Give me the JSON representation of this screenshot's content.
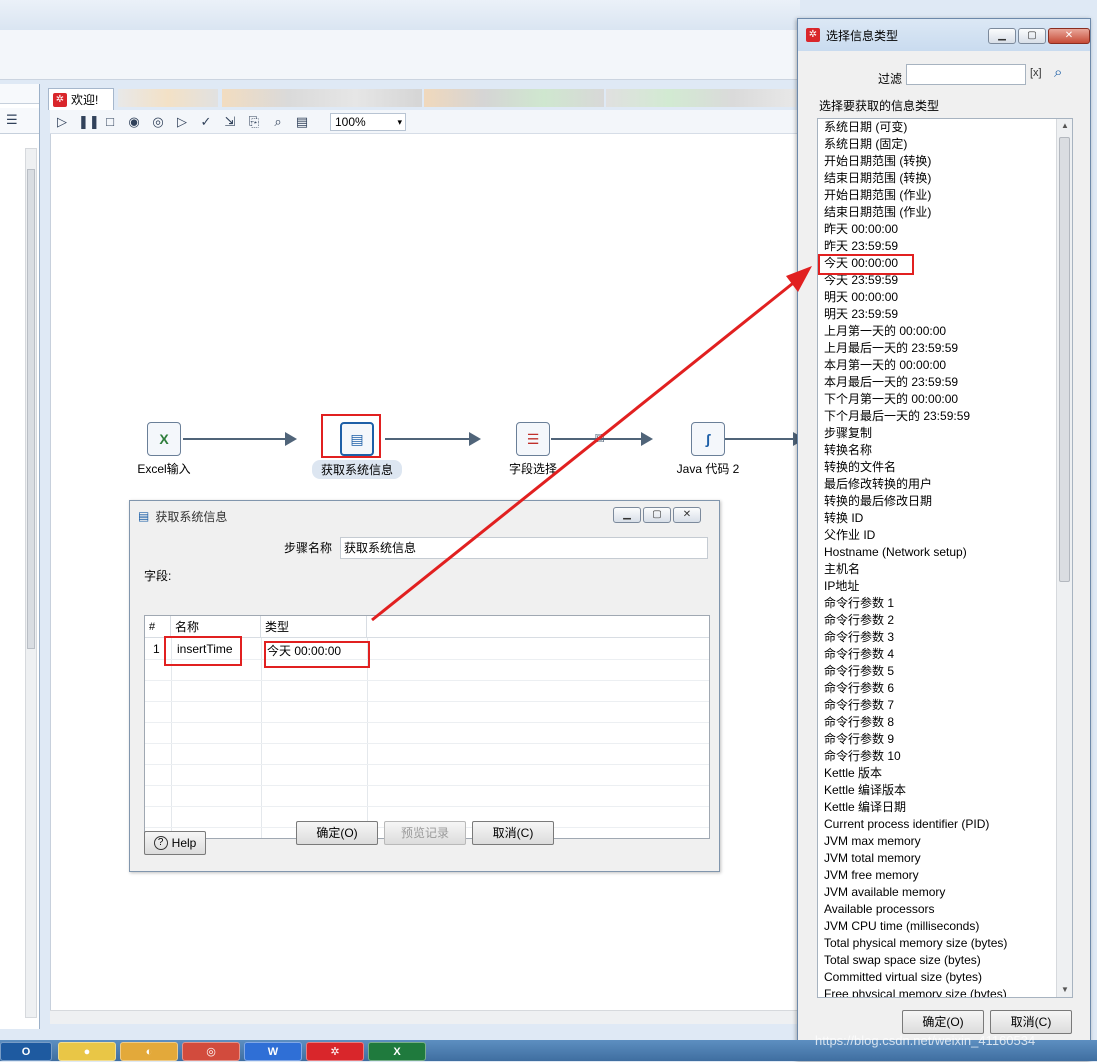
{
  "main": {
    "tab_welcome": "欢迎!",
    "zoom": "100%",
    "steps": [
      {
        "label": "Excel输入",
        "icon": "excel-input-icon"
      },
      {
        "label": "获取系统信息",
        "icon": "system-info-icon"
      },
      {
        "label": "字段选择",
        "icon": "select-values-icon"
      },
      {
        "label": "Java 代码 2",
        "icon": "java-code-icon"
      }
    ]
  },
  "sysinfo_dialog": {
    "title": "获取系统信息",
    "step_name_label": "步骤名称",
    "step_name_value": "获取系统信息",
    "fields_label": "字段:",
    "columns": [
      "#",
      "名称",
      "类型"
    ],
    "rows": [
      {
        "num": "1",
        "name": "insertTime",
        "type": "今天 00:00:00"
      }
    ],
    "buttons": {
      "help": "Help",
      "ok": "确定(O)",
      "preview": "预览记录",
      "cancel": "取消(C)"
    }
  },
  "select_dialog": {
    "title": "选择信息类型",
    "filter_label": "过滤",
    "filter_value": "",
    "list_label": "选择要获取的信息类型",
    "items": [
      "系统日期 (可变)",
      "系统日期 (固定)",
      "开始日期范围 (转换)",
      "结束日期范围 (转换)",
      "开始日期范围 (作业)",
      "结束日期范围 (作业)",
      "昨天 00:00:00",
      "昨天 23:59:59",
      "今天 00:00:00",
      "今天 23:59:59",
      "明天 00:00:00",
      "明天 23:59:59",
      "上月第一天的 00:00:00",
      "上月最后一天的 23:59:59",
      "本月第一天的 00:00:00",
      "本月最后一天的  23:59:59",
      "下个月第一天的 00:00:00",
      "下个月最后一天的 23:59:59",
      "步骤复制",
      "转换名称",
      "转换的文件名",
      "最后修改转换的用户",
      "转换的最后修改日期",
      "转换 ID",
      "父作业 ID",
      "Hostname (Network setup)",
      "主机名",
      "IP地址",
      "命令行参数 1",
      "命令行参数 2",
      "命令行参数 3",
      "命令行参数 4",
      "命令行参数 5",
      "命令行参数 6",
      "命令行参数 7",
      "命令行参数 8",
      "命令行参数 9",
      "命令行参数 10",
      "Kettle 版本",
      "Kettle 编译版本",
      "Kettle 编译日期",
      "Current process identifier (PID)",
      "JVM max memory",
      "JVM total memory",
      "JVM free memory",
      "JVM available memory",
      "Available processors",
      "JVM CPU time (milliseconds)",
      "Total physical memory size (bytes)",
      "Total swap space size (bytes)",
      "Committed virtual size (bytes)",
      "Free physical memory size (bytes)"
    ],
    "selected_item": "今天 00:00:00",
    "buttons": {
      "ok": "确定(O)",
      "cancel": "取消(C)"
    }
  },
  "taskbar": {
    "apps": [
      "outlook-icon",
      "wechat-icon",
      "app-icon",
      "chrome-icon",
      "wps-icon",
      "kettle-icon",
      "excel-icon"
    ]
  },
  "watermark": "https://blog.csdn.net/weixin_41160534",
  "colors": {
    "highlight": "#e12020",
    "accent": "#1d5fa7"
  }
}
